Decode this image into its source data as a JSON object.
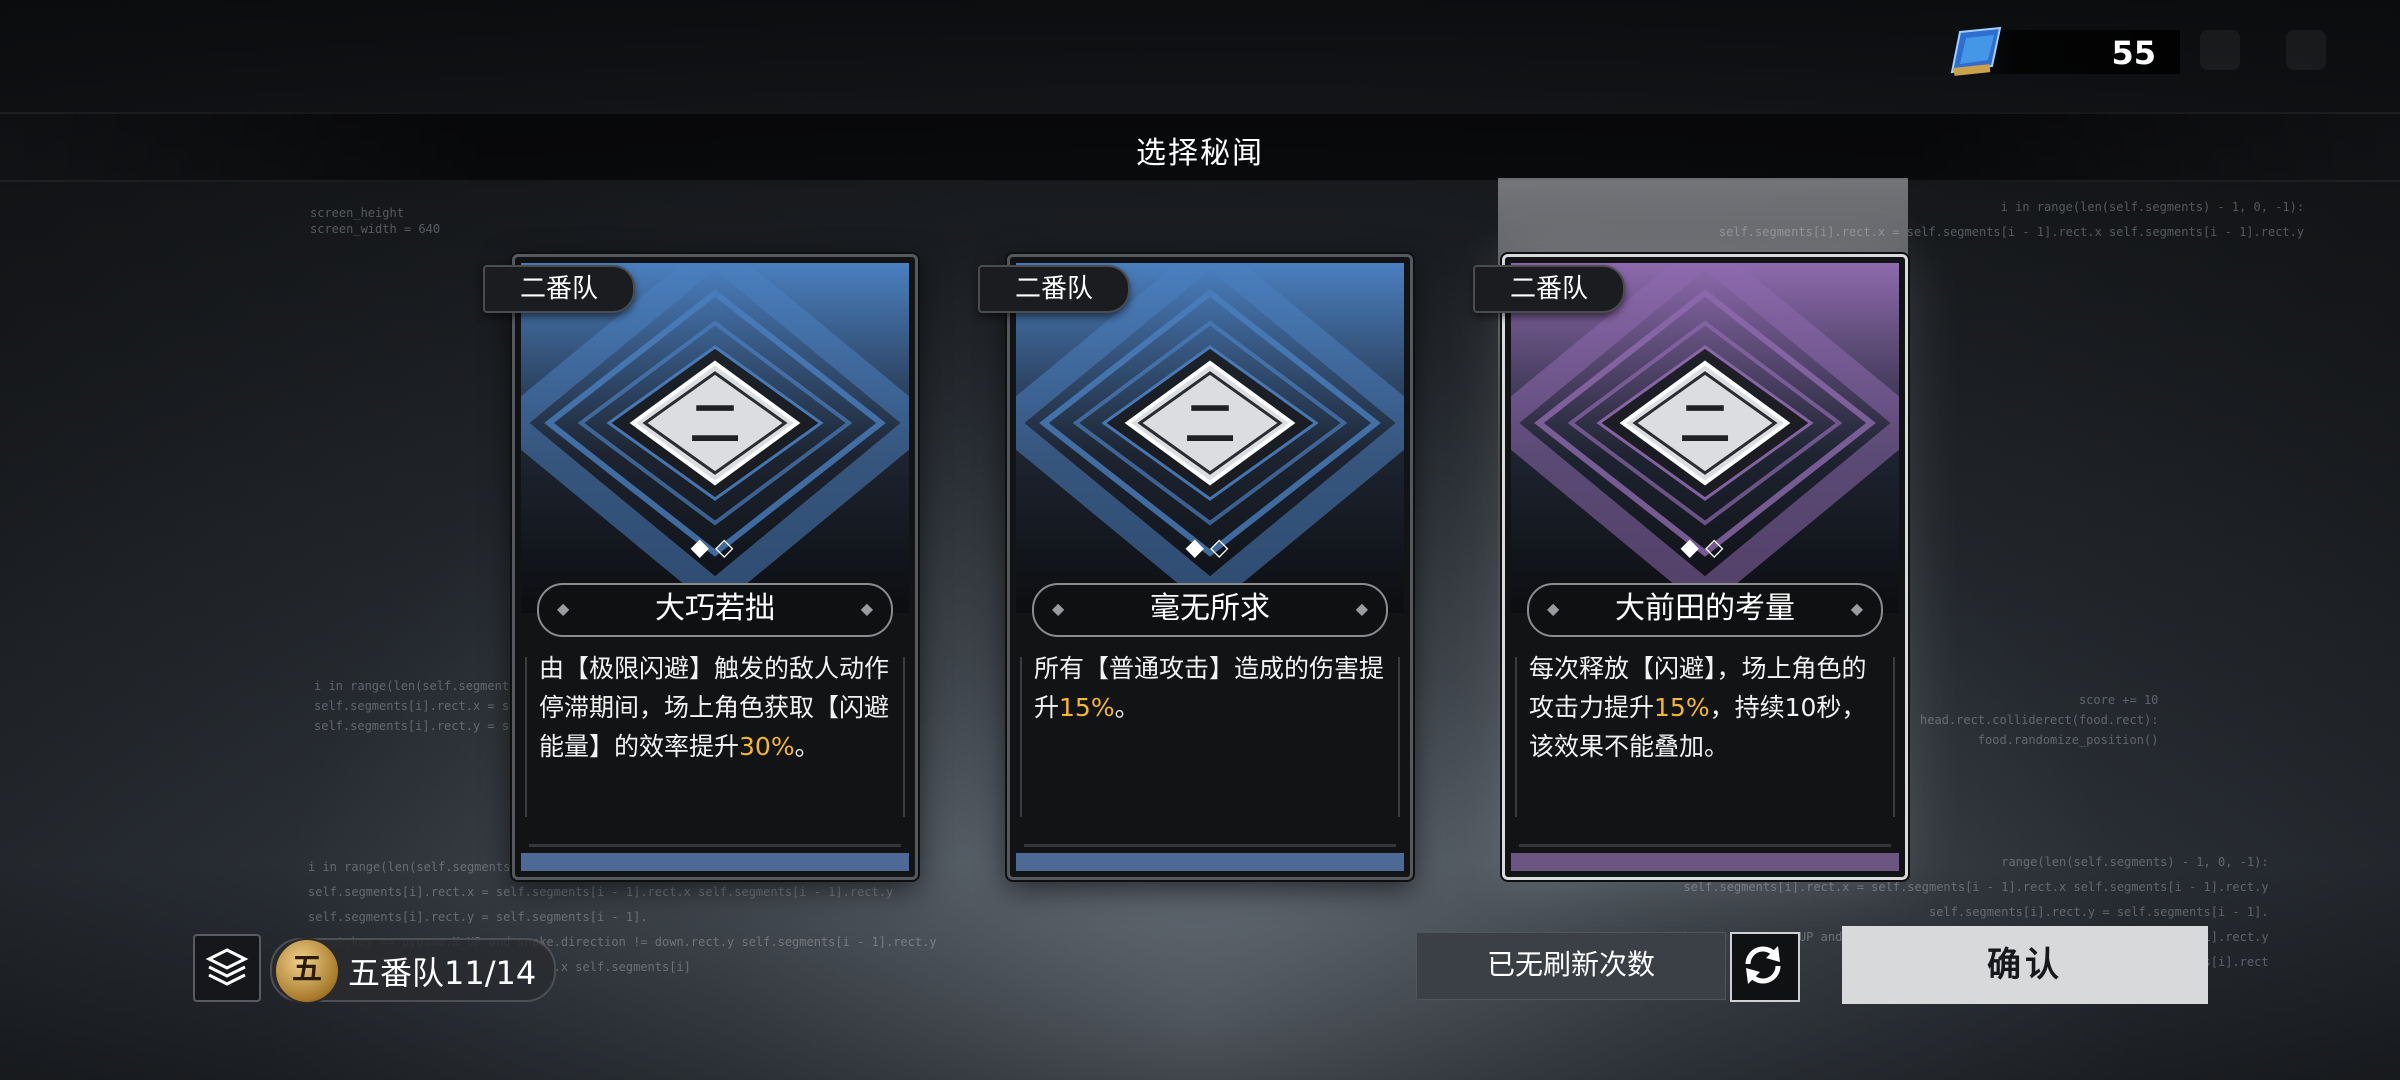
{
  "currency": {
    "value": "55",
    "icon": "data-chip-icon"
  },
  "title": "选择秘闻",
  "cards": [
    {
      "tag": "二番队",
      "emblem": "二",
      "name": "大巧若拙",
      "desc_parts": [
        {
          "t": "由【极限闪避】触发的敌人动作停滞期间，场上角色获取【闪避能量】的效率提升"
        },
        {
          "t": "30%",
          "hl": true
        },
        {
          "t": "。"
        }
      ],
      "theme": "#4a7fbf",
      "bar": "#4d6a96",
      "selected": false
    },
    {
      "tag": "二番队",
      "emblem": "二",
      "name": "毫无所求",
      "desc_parts": [
        {
          "t": "所有【普通攻击】造成的伤害提升"
        },
        {
          "t": "15%",
          "hl": true
        },
        {
          "t": "。"
        }
      ],
      "theme": "#4a7fbf",
      "bar": "#4d6a96",
      "selected": false
    },
    {
      "tag": "二番队",
      "emblem": "二",
      "name": "大前田的考量",
      "desc_parts": [
        {
          "t": "每次释放【闪避】，场上角色的攻击力提升"
        },
        {
          "t": "15%",
          "hl": true
        },
        {
          "t": "，持续10秒，该效果不能叠加。"
        }
      ],
      "theme": "#8e6aae",
      "bar": "#6a5680",
      "selected": true
    }
  ],
  "team": {
    "badge": "五",
    "label": "五番队11/14"
  },
  "refresh_status": "已无刷新次数",
  "confirm_label": "确认",
  "colors": {
    "highlight": "#f5b62a",
    "confirm_bg": "#d8d9db"
  },
  "bg_text": {
    "a": "screen_height\nscreen_width = 640",
    "b": "i in range(len(self.segments) - 1, 0, -1):\n    self.segments[i].rect.x = self.segments[i - 1].rect.x self.segments[i - 1].rect.y",
    "c": "i in range(len(self.segments) - 1, 0, -1):\nself.segments[i].rect.x = self.segments[i - 1]\nself.segments[i].rect.y = self.segments[i",
    "d": "score += 10\nhead.rect.colliderect(food.rect):\n    food.randomize_position()",
    "e": "i in range(len(self.segments) - 1, 0, -1):\nself.segments[i].rect.x = self.segments[i - 1].rect.x self.segments[i - 1].rect.y\nself.segments[i].rect.y = self.segments[i - 1].\nevent.key == pygame.K_UP and snake.direction != down.rect.y self.segments[i - 1].rect.y\n                                  .x self.segments[i]",
    "f": "range(len(self.segments) - 1, 0, -1):\nself.segments[i].rect.x = self.segments[i - 1].rect.x self.segments[i - 1].rect.y\nself.segments[i].rect.y = self.segments[i - 1].\nevent.key == pygame.K_UP and snake.direction != down.rect.x self.segments[i - 1].rect.y\nself.segments[i].rect"
  }
}
